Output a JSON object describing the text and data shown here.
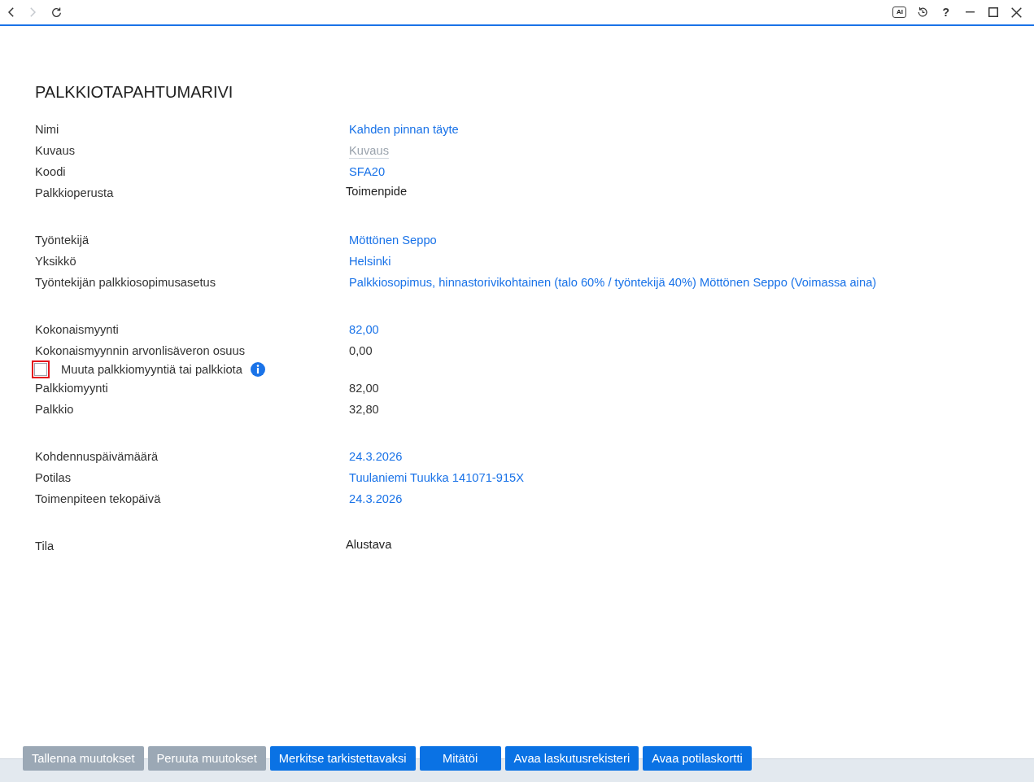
{
  "navigation": {
    "back_disabled": false,
    "forward_disabled": true
  },
  "toolbar": {
    "ai_badge": "AI",
    "help": "?"
  },
  "title": "PALKKIOTAPAHTUMARIVI",
  "groups": [
    {
      "rows": [
        {
          "kind": "link",
          "label": "Nimi",
          "value": "Kahden pinnan täyte"
        },
        {
          "kind": "field",
          "label": "Kuvaus",
          "placeholder": "Kuvaus"
        },
        {
          "kind": "link",
          "label": "Koodi",
          "value": "SFA20"
        },
        {
          "kind": "option",
          "label": "Palkkioperusta",
          "value": "Toimenpide"
        }
      ]
    },
    {
      "rows": [
        {
          "kind": "link",
          "label": "Työntekijä",
          "value": "Möttönen Seppo"
        },
        {
          "kind": "link",
          "label": "Yksikkö",
          "value": "Helsinki"
        },
        {
          "kind": "link",
          "label": "Työntekijän palkkiosopimusasetus",
          "value": "Palkkiosopimus, hinnastorivikohtainen (talo 60% / työntekijä 40%) Möttönen Seppo (Voimassa aina)"
        }
      ]
    },
    {
      "rows": [
        {
          "kind": "link",
          "label": "Kokonaismyynti",
          "value": "82,00"
        },
        {
          "kind": "text",
          "label": "Kokonaismyynnin arvonlisäveron osuus",
          "value": "0,00"
        },
        {
          "kind": "checkbox",
          "label": "Muuta palkkiomyyntiä tai palkkiota",
          "checked": false,
          "focused": true
        },
        {
          "kind": "text",
          "label": "Palkkiomyynti",
          "value": "82,00"
        },
        {
          "kind": "text",
          "label": "Palkkio",
          "value": "32,80"
        }
      ]
    },
    {
      "rows": [
        {
          "kind": "link",
          "label": "Kohdennuspäivämäärä",
          "value": "24.3.2026"
        },
        {
          "kind": "link",
          "label": "Potilas",
          "value": "Tuulaniemi Tuukka 141071-915X"
        },
        {
          "kind": "link",
          "label": "Toimenpiteen tekopäivä",
          "value": "24.3.2026"
        }
      ]
    },
    {
      "rows": [
        {
          "kind": "option",
          "label": "Tila",
          "value": "Alustava"
        }
      ]
    }
  ],
  "buttons": [
    {
      "label": "Tallenna muutokset",
      "disabled": true
    },
    {
      "label": "Peruuta muutokset",
      "disabled": true
    },
    {
      "label": "Merkitse tarkistettavaksi",
      "disabled": false
    },
    {
      "label": "Mitätöi",
      "disabled": false
    },
    {
      "label": "Avaa laskutusrekisteri",
      "disabled": false
    },
    {
      "label": "Avaa potilaskortti",
      "disabled": false
    }
  ]
}
